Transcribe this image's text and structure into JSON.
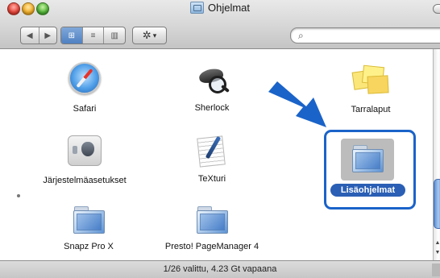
{
  "window": {
    "title": "Ohjelmat"
  },
  "toolbar": {
    "nav_back_icon": "◀",
    "nav_forward_icon": "▶",
    "view_icon_mode": "⊞",
    "view_list_mode": "≡",
    "view_column_mode": "▥",
    "action_icon": "✲",
    "action_chevron": "▾",
    "search_placeholder": "",
    "search_icon": "⌕"
  },
  "items": [
    {
      "label": "Safari",
      "icon": "safari-icon"
    },
    {
      "label": "Sherlock",
      "icon": "sherlock-icon"
    },
    {
      "label": "Tarralaput",
      "icon": "stickies-icon"
    },
    {
      "label": "Järjestelmäasetukset",
      "icon": "system-preferences-icon"
    },
    {
      "label": "TeXturi",
      "icon": "textedit-icon"
    },
    {
      "label": "Lisäohjelmat",
      "icon": "folder-icon",
      "selected": true
    },
    {
      "label": "Snapz Pro X",
      "icon": "folder-icon"
    },
    {
      "label": "Presto! PageManager 4",
      "icon": "folder-icon"
    }
  ],
  "status": {
    "text": "1/26 valittu, 4.23 Gt vapaana"
  },
  "scrollbar": {
    "up_icon": "▲",
    "down_icon": "▼"
  },
  "colors": {
    "selection": "#2a5fb5",
    "highlight_box": "#1a63c9",
    "arrow": "#1a63c9"
  }
}
